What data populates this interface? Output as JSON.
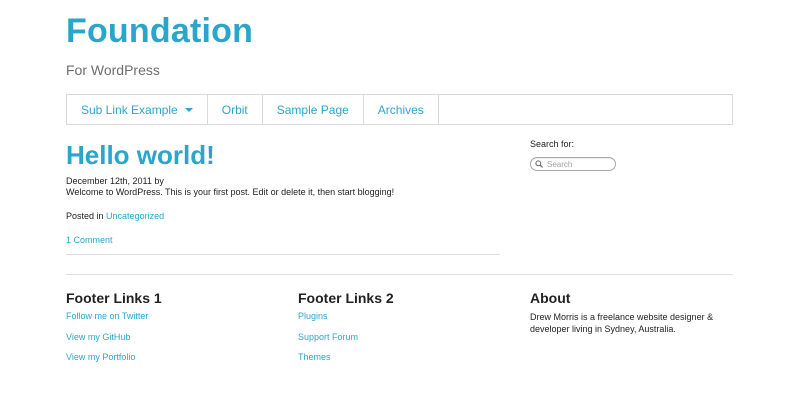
{
  "site": {
    "title": "Foundation",
    "tagline": "For WordPress"
  },
  "nav": {
    "items": [
      {
        "label": "Sub Link Example",
        "has_dropdown": true
      },
      {
        "label": "Orbit"
      },
      {
        "label": "Sample Page"
      },
      {
        "label": "Archives"
      }
    ]
  },
  "post": {
    "title": "Hello world!",
    "meta": "December 12th, 2011 by",
    "body": "Welcome to WordPress. This is your first post. Edit or delete it, then start blogging!",
    "posted_in_label": "Posted in",
    "category": "Uncategorized",
    "comments": "1 Comment"
  },
  "sidebar": {
    "search_label": "Search for:",
    "search_placeholder": "Search"
  },
  "footer": {
    "col1": {
      "title": "Footer Links 1",
      "links": [
        "Follow me on Twitter",
        "View my GitHub",
        "View my Portfolio"
      ]
    },
    "col2": {
      "title": "Footer Links 2",
      "links": [
        "Plugins",
        "Support Forum",
        "Themes"
      ]
    },
    "about": {
      "title": "About",
      "text": "Drew Morris is a freelance website designer & developer living in Sydney, Australia."
    }
  },
  "colors": {
    "accent": "#2ba6cb",
    "text": "#222222",
    "muted": "#6f6f6f",
    "border": "#d9d9d9"
  }
}
